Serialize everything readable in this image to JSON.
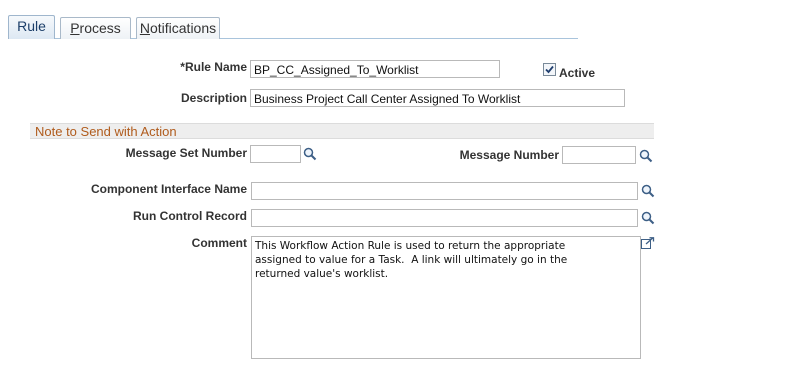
{
  "tabs": [
    {
      "label": "Rule",
      "underline_char": "",
      "rest": "Rule"
    },
    {
      "label": "Process",
      "underline_char": "P",
      "rest": "rocess"
    },
    {
      "label": "Notifications",
      "underline_char": "N",
      "rest": "otifications"
    }
  ],
  "rule_name": {
    "label": "*Rule Name",
    "value": "BP_CC_Assigned_To_Worklist"
  },
  "active": {
    "label": "Active",
    "checked": true
  },
  "description": {
    "label": "Description",
    "value": "Business Project Call Center Assigned To Worklist"
  },
  "section": {
    "title": "Note to Send with Action"
  },
  "message_set_number": {
    "label": "Message Set Number",
    "value": ""
  },
  "message_number": {
    "label": "Message Number",
    "value": ""
  },
  "component_interface_name": {
    "label": "Component Interface Name",
    "value": ""
  },
  "run_control_record": {
    "label": "Run Control Record",
    "value": ""
  },
  "comment": {
    "label": "Comment",
    "value": "This Workflow Action Rule is used to return the appropriate\nassigned to value for a Task.  A link will ultimately go in the\nreturned value's worklist."
  },
  "icons": {
    "lookup": "magnifier-icon",
    "expand": "expand-icon",
    "check": "checkmark-icon"
  }
}
